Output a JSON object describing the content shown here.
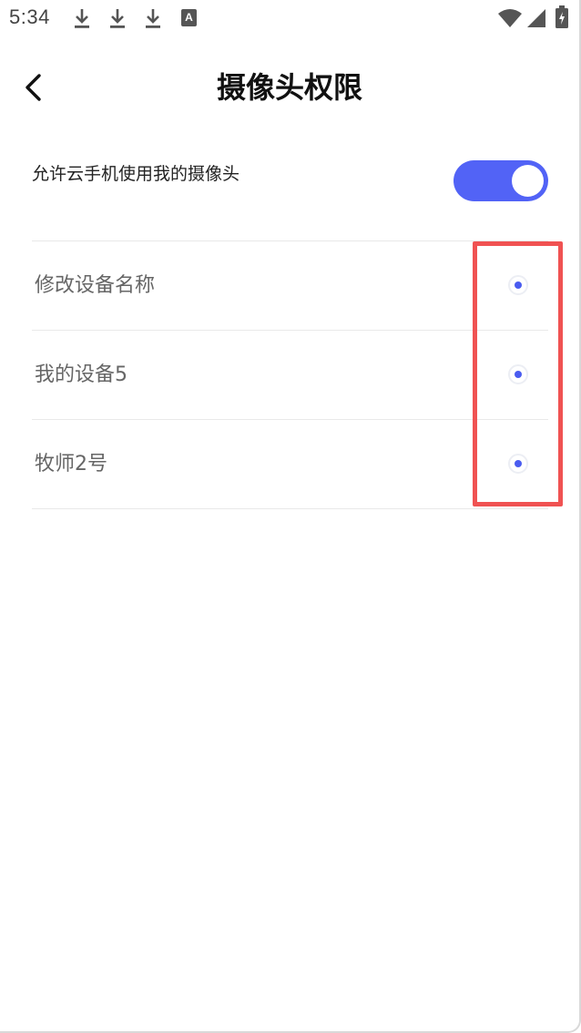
{
  "status_bar": {
    "time": "5:34",
    "notification_icons": [
      "download-icon",
      "download-icon",
      "download-icon",
      "a-icon"
    ],
    "a_icon_letter": "A",
    "right_icons": [
      "wifi-icon",
      "signal-icon",
      "battery-icon"
    ]
  },
  "header": {
    "back_icon": "chevron-left-icon",
    "title": "摄像头权限"
  },
  "permission": {
    "label": "允许云手机使用我的摄像头",
    "enabled": true,
    "accent_color": "#5263f6"
  },
  "devices": [
    {
      "name": "修改设备名称",
      "selected": true
    },
    {
      "name": "我的设备5",
      "selected": true
    },
    {
      "name": "牧师2号",
      "selected": true
    }
  ],
  "colors": {
    "radio_dot": "#4a5cf0",
    "highlight": "#f05252"
  }
}
